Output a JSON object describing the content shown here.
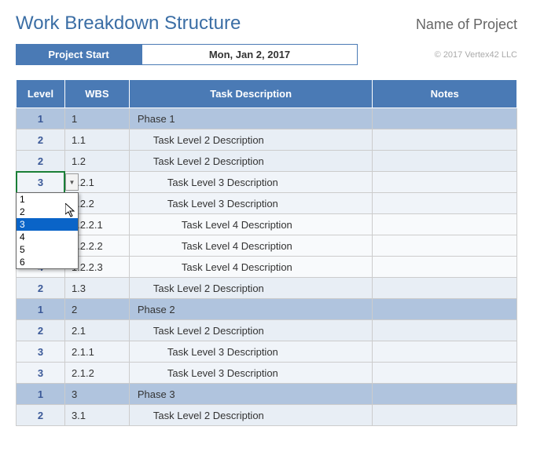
{
  "header": {
    "title": "Work Breakdown Structure",
    "project_name": "Name of Project"
  },
  "start": {
    "label": "Project Start",
    "date": "Mon, Jan 2, 2017"
  },
  "copyright": "© 2017 Vertex42 LLC",
  "columns": {
    "level": "Level",
    "wbs": "WBS",
    "task": "Task Description",
    "notes": "Notes"
  },
  "dropdown": {
    "options": [
      "1",
      "2",
      "3",
      "4",
      "5",
      "6"
    ],
    "selected_index": 2
  },
  "rows": [
    {
      "level": "1",
      "wbs": "1",
      "task": "Phase 1",
      "indent": 1,
      "cls": "row-l1"
    },
    {
      "level": "2",
      "wbs": "1.1",
      "task": "Task Level 2 Description",
      "indent": 2,
      "cls": "row-l2"
    },
    {
      "level": "2",
      "wbs": "1.2",
      "task": "Task Level 2 Description",
      "indent": 2,
      "cls": "row-l2"
    },
    {
      "level": "3",
      "wbs": "1.2.1",
      "task": "Task Level 3 Description",
      "indent": 3,
      "cls": "row-l3",
      "selected": true
    },
    {
      "level": "",
      "wbs": "1.2.2",
      "task": "Task Level 3 Description",
      "indent": 3,
      "cls": "row-l3"
    },
    {
      "level": "",
      "wbs": "1.2.2.1",
      "task": "Task Level 4 Description",
      "indent": 4,
      "cls": "row-l4"
    },
    {
      "level": "",
      "wbs": "1.2.2.2",
      "task": "Task Level 4 Description",
      "indent": 4,
      "cls": "row-l4"
    },
    {
      "level": "4",
      "wbs": "1.2.2.3",
      "task": "Task Level 4 Description",
      "indent": 4,
      "cls": "row-l4"
    },
    {
      "level": "2",
      "wbs": "1.3",
      "task": "Task Level 2 Description",
      "indent": 2,
      "cls": "row-l2"
    },
    {
      "level": "1",
      "wbs": "2",
      "task": "Phase 2",
      "indent": 1,
      "cls": "row-l1"
    },
    {
      "level": "2",
      "wbs": "2.1",
      "task": "Task Level 2 Description",
      "indent": 2,
      "cls": "row-l2"
    },
    {
      "level": "3",
      "wbs": "2.1.1",
      "task": "Task Level 3 Description",
      "indent": 3,
      "cls": "row-l3"
    },
    {
      "level": "3",
      "wbs": "2.1.2",
      "task": "Task Level 3 Description",
      "indent": 3,
      "cls": "row-l3"
    },
    {
      "level": "1",
      "wbs": "3",
      "task": "Phase 3",
      "indent": 1,
      "cls": "row-l1"
    },
    {
      "level": "2",
      "wbs": "3.1",
      "task": "Task Level 2 Description",
      "indent": 2,
      "cls": "row-l2"
    }
  ]
}
